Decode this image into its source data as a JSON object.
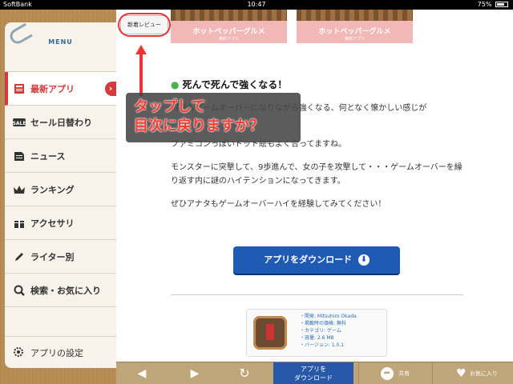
{
  "status_bar": {
    "carrier": "SoftBank",
    "time": "10:47",
    "battery": "75%",
    "battery_level": 0.75
  },
  "sidebar": {
    "title": "MENU",
    "items": [
      {
        "label": "最新アプリ",
        "icon": "newspaper-icon",
        "active": true
      },
      {
        "label": "セール日替わり",
        "icon": "sale-tag-icon"
      },
      {
        "label": "ニュース",
        "icon": "news-icon"
      },
      {
        "label": "ランキング",
        "icon": "crown-icon"
      },
      {
        "label": "アクセサリ",
        "icon": "gift-icon"
      },
      {
        "label": "ライター別",
        "icon": "pencil-icon"
      },
      {
        "label": "検索・お気に入り",
        "icon": "search-icon"
      }
    ],
    "settings_label": "アプリの設定"
  },
  "content": {
    "back_button": "新着レビュー",
    "thumbnails": [
      {
        "label": "ホットペッパーグルメ",
        "sub": "無料アプリ"
      },
      {
        "label": "ホットペッパーグルメ",
        "sub": "無料アプリ"
      }
    ],
    "callout": {
      "line1": "タップして",
      "line2": "目次に戻りますか？"
    },
    "heading": "死んで死んで強くなる！",
    "paragraphs": [
      "何度もゲームオーバーになりながら強くなる、何となく懐かしい感じが",
      "ファミコンっぽいドット絵もよく合ってますね。",
      "モンスターに突撃して、9歩進んで、女の子を攻撃して・・・ゲームオーバーを繰り返す内に謎のハイテンションになってきます。",
      "ぜひアナタもゲームオーバーハイを経験してみてください！"
    ],
    "download_button": "アプリをダウンロード",
    "app_info": [
      "・開発: Mitsuhiro Okada",
      "・掲載時の価格: 無料",
      "・カテゴリ: ゲーム",
      "・容量: 2.6 MB",
      "・バージョン: 1.0.1"
    ]
  },
  "toolbar": {
    "download_line1": "アプリを",
    "download_line2": "ダウンロード",
    "share": "共有",
    "favorite": "お気に入り"
  }
}
